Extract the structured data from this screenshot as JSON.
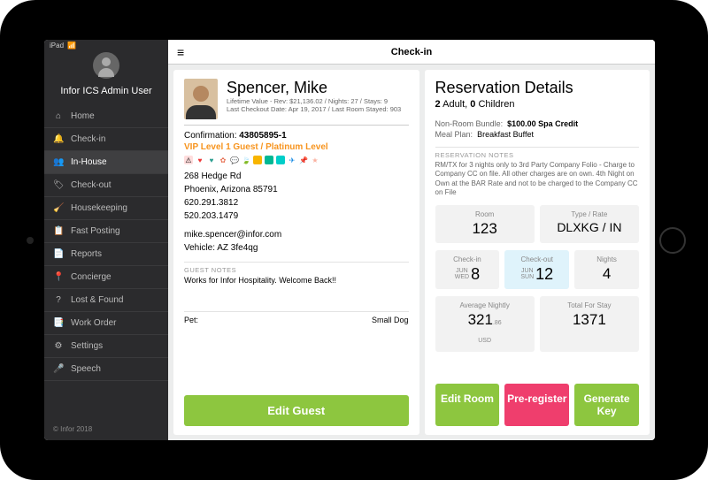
{
  "status": {
    "device": "iPad",
    "wifi": "📶"
  },
  "user": {
    "label": "Infor ICS Admin User"
  },
  "sidebar": {
    "items": [
      {
        "icon": "⌂",
        "label": "Home"
      },
      {
        "icon": "🔔",
        "label": "Check-in"
      },
      {
        "icon": "👥",
        "label": "In-House"
      },
      {
        "icon": "🏷",
        "label": "Check-out"
      },
      {
        "icon": "🧹",
        "label": "Housekeeping"
      },
      {
        "icon": "📋",
        "label": "Fast Posting"
      },
      {
        "icon": "📄",
        "label": "Reports"
      },
      {
        "icon": "📍",
        "label": "Concierge"
      },
      {
        "icon": "?",
        "label": "Lost & Found"
      },
      {
        "icon": "📑",
        "label": "Work Order"
      },
      {
        "icon": "⚙",
        "label": "Settings"
      },
      {
        "icon": "🎤",
        "label": "Speech"
      }
    ],
    "footer": "© Infor 2018"
  },
  "topbar": {
    "title": "Check-in"
  },
  "guest": {
    "name": "Spencer, Mike",
    "lifetime": "Lifetime Value - Rev: $21,136.02 / Nights: 27 / Stays: 9",
    "last": "Last Checkout Date: Apr 19, 2017 / Last Room Stayed: 903",
    "confirmation_label": "Confirmation:",
    "confirmation": "43805895-1",
    "vip": "VIP Level 1 Guest / Platinum Level",
    "addr1": "268 Hedge Rd",
    "addr2": "Phoenix, Arizona 85791",
    "phone1": "620.291.3812",
    "phone2": "520.203.1479",
    "email": "mike.spencer@infor.com",
    "vehicle": "Vehicle: AZ 3fe4qg",
    "notes_label": "GUEST NOTES",
    "notes": "Works for Infor Hospitality. Welcome Back!!",
    "pet_label": "Pet:",
    "pet": "Small Dog",
    "edit_btn": "Edit Guest"
  },
  "reservation": {
    "title": "Reservation Details",
    "occupancy_adult_n": "2",
    "occupancy_adult_l": "Adult,  ",
    "occupancy_child_n": "0",
    "occupancy_child_l": "Children",
    "bundle_label": "Non-Room Bundle:",
    "bundle": "$100.00 Spa Credit",
    "meal_label": "Meal Plan:",
    "meal": "Breakfast Buffet",
    "notes_label": "RESERVATION NOTES",
    "notes": "RM/TX for 3 nights only to 3rd Party Company Folio - Charge to Company CC on file. All other charges are on own. 4th Night on Own at the BAR Rate and not to be charged to the Company CC on File",
    "tiles1": {
      "room_l": "Room",
      "room_v": "123",
      "rate_l": "Type / Rate",
      "rate_v": "DLXKG / IN"
    },
    "tiles2": {
      "ci_l": "Check-in",
      "ci_m": "JUN",
      "ci_w": "WED",
      "ci_d": "8",
      "co_l": "Check-out",
      "co_m": "JUN",
      "co_w": "SUN",
      "co_d": "12",
      "ni_l": "Nights",
      "ni_v": "4"
    },
    "tiles3": {
      "avg_l": "Average Nightly",
      "avg_v": "321",
      "avg_c": ".86",
      "avg_u": "USD",
      "tot_l": "Total For Stay",
      "tot_v": "1371"
    },
    "buttons": {
      "edit": "Edit Room",
      "prereg": "Pre-register",
      "genkey": "Generate Key"
    }
  }
}
